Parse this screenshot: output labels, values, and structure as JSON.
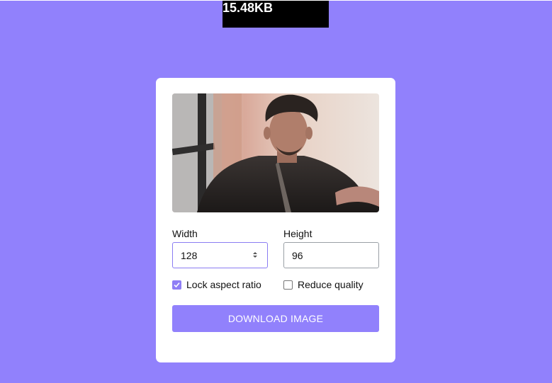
{
  "file_size": "15.48KB",
  "image_preview": {
    "alt": "uploaded photo preview"
  },
  "width": {
    "label": "Width",
    "value": "128"
  },
  "height": {
    "label": "Height",
    "value": "96"
  },
  "options": {
    "lock_aspect_ratio": {
      "label": "Lock aspect ratio",
      "checked": true
    },
    "reduce_quality": {
      "label": "Reduce quality",
      "checked": false
    }
  },
  "download_label": "DOWNLOAD IMAGE",
  "colors": {
    "accent": "#9181fc",
    "background": "#9181fc",
    "card": "#ffffff"
  }
}
